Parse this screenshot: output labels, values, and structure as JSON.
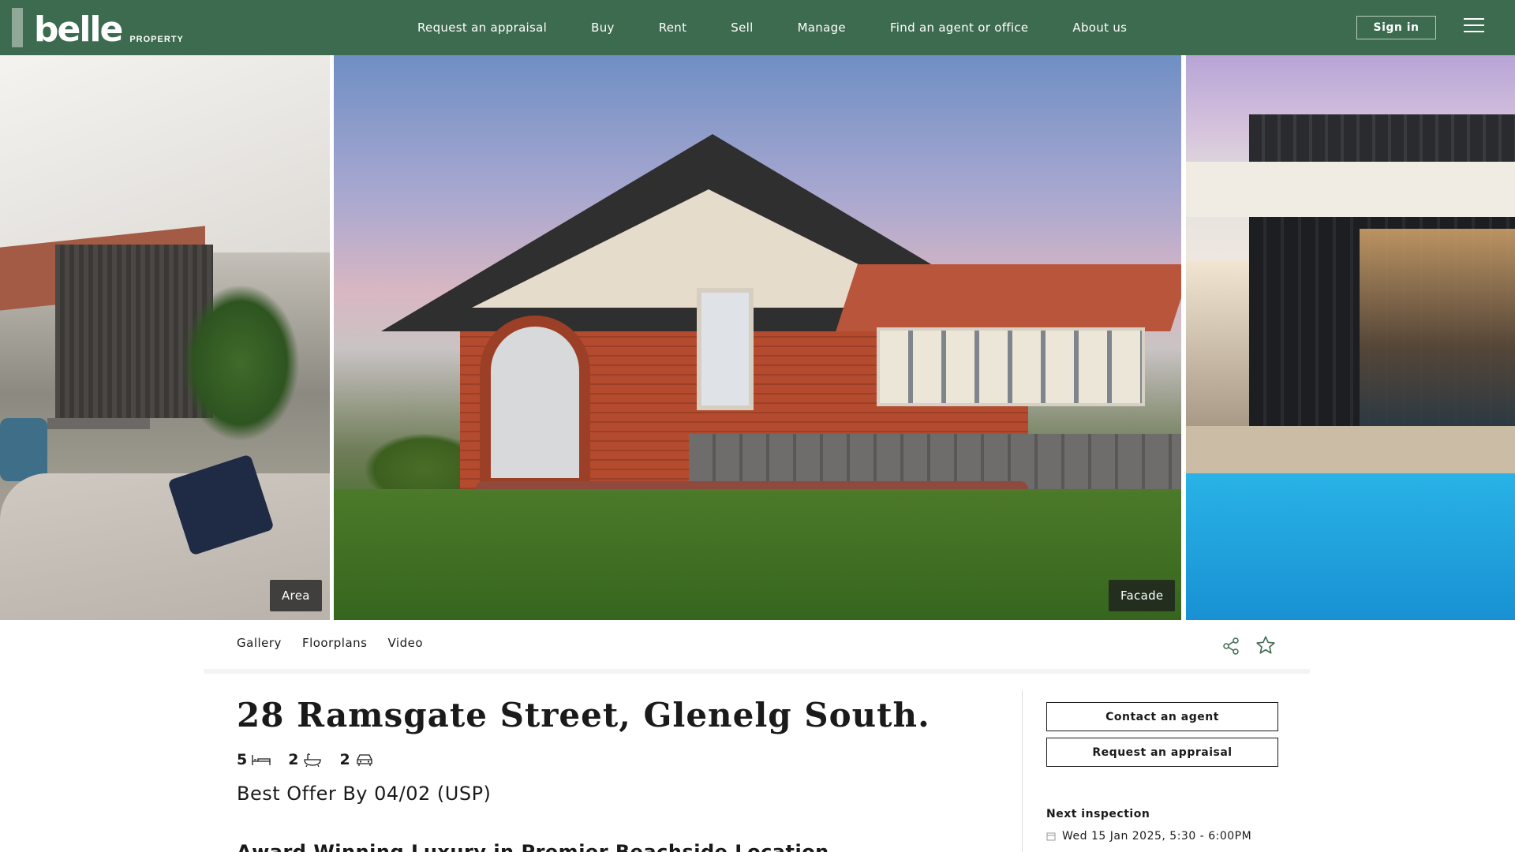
{
  "brand": {
    "word": "belle",
    "sub": "PROPERTY"
  },
  "nav": [
    {
      "label": "Request an appraisal"
    },
    {
      "label": "Buy"
    },
    {
      "label": "Rent"
    },
    {
      "label": "Sell"
    },
    {
      "label": "Manage"
    },
    {
      "label": "Find an agent or office"
    },
    {
      "label": "About us"
    }
  ],
  "header": {
    "signin_label": "Sign in",
    "menu_icon": "hamburger-menu-icon"
  },
  "colors": {
    "header_bg": "#3d6b4f",
    "accent": "#3d6b4f"
  },
  "gallery": {
    "tags": {
      "left": "Area",
      "center": "Facade"
    }
  },
  "subnav": [
    {
      "label": "Gallery"
    },
    {
      "label": "Floorplans"
    },
    {
      "label": "Video"
    }
  ],
  "listing": {
    "address": "28 Ramsgate Street, Glenelg South.",
    "beds": "5",
    "baths": "2",
    "cars": "2",
    "price": "Best Offer By 04/02 (USP)",
    "teaser": "Award Winning Luxury in Premier Beachside Location"
  },
  "sidebar": {
    "contact_label": "Contact an agent",
    "appraisal_label": "Request an appraisal",
    "inspection_title": "Next inspection",
    "inspection_time": "Wed 15 Jan 2025, 5:30 - 6:00PM"
  }
}
